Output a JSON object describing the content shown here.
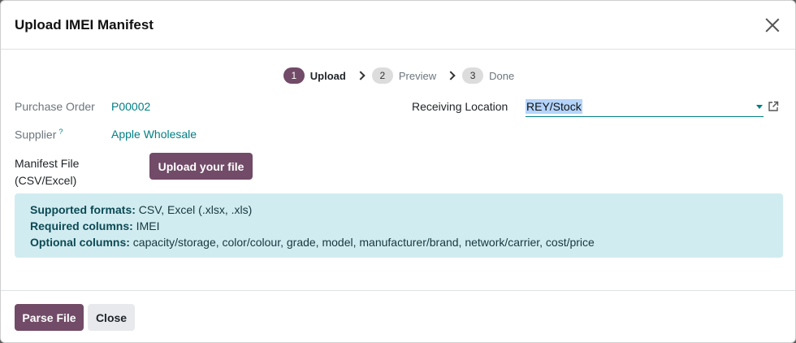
{
  "dialog": {
    "title": "Upload IMEI Manifest"
  },
  "steps": [
    {
      "number": "1",
      "label": "Upload"
    },
    {
      "number": "2",
      "label": "Preview"
    },
    {
      "number": "3",
      "label": "Done"
    }
  ],
  "fields": {
    "purchase_order_label": "Purchase Order",
    "purchase_order_value": "P00002",
    "supplier_label": "Supplier",
    "supplier_help": "?",
    "supplier_value": "Apple Wholesale",
    "receiving_location_label": "Receiving Location",
    "receiving_location_value": "REY/Stock",
    "manifest_label_line1": "Manifest File",
    "manifest_label_line2": "(CSV/Excel)",
    "upload_button": "Upload your file"
  },
  "info": {
    "supported_label": "Supported formats:",
    "supported_value": " CSV, Excel (.xlsx, .xls)",
    "required_label": "Required columns:",
    "required_value": " IMEI",
    "optional_label": "Optional columns:",
    "optional_value": " capacity/storage, color/colour, grade, model, manufacturer/brand, network/carrier, cost/price"
  },
  "footer": {
    "parse_button": "Parse File",
    "close_button": "Close"
  },
  "colors": {
    "brand": "#714b67",
    "link": "#017e84",
    "info_bg": "#d1ecf1"
  },
  "icons": {
    "close": "close-icon",
    "chevron": "chevron-right-icon",
    "dropdown": "caret-down-icon",
    "external": "external-link-icon"
  }
}
